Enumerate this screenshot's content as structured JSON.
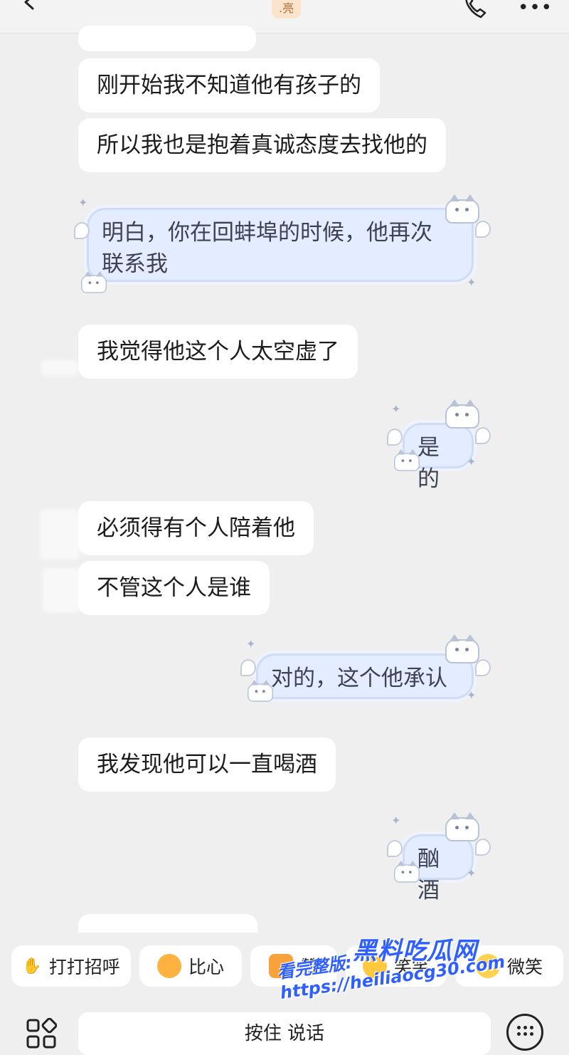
{
  "header": {
    "name_badge": ".亮",
    "more_label": "•••"
  },
  "messages": [
    {
      "side": "left",
      "text": ""
    },
    {
      "side": "left",
      "text": "刚开始我不知道他有孩子的"
    },
    {
      "side": "left",
      "text": "所以我也是抱着真诚态度去找他的"
    },
    {
      "side": "right",
      "text": "明白，你在回蚌埠的时候，他再次联系我",
      "line1": "明白，你在回蚌埠的时候，他再次",
      "line2": "联系我"
    },
    {
      "side": "left",
      "text": "我觉得他这个人太空虚了"
    },
    {
      "side": "right",
      "text": "是的"
    },
    {
      "side": "left",
      "text": "必须得有个人陪着他"
    },
    {
      "side": "left",
      "text": "不管这个人是谁"
    },
    {
      "side": "right",
      "text": "对的，这个他承认"
    },
    {
      "side": "left",
      "text": "我发现他可以一直喝酒"
    },
    {
      "side": "right",
      "text": "酗酒"
    },
    {
      "side": "left",
      "text": ""
    }
  ],
  "quick_replies": [
    {
      "label": "打打招呼",
      "icon": "wave-icon"
    },
    {
      "label": "比心",
      "icon": "heart-hands-icon"
    },
    {
      "label": "赞",
      "icon": "thumbs-up-icon"
    },
    {
      "label": "笑笑",
      "icon": "laugh-icon"
    },
    {
      "label": "微笑",
      "icon": "smile-icon"
    }
  ],
  "input": {
    "hold_to_talk": "按住 说话"
  },
  "watermark": {
    "brand": "黑料吃瓜网",
    "url_text": "看完整版: https://heiliaocg30.com"
  },
  "colors": {
    "chat_bg": "#efefef",
    "bubble": "#ffffff",
    "sticker_bg": "#e3edff",
    "watermark": "#2f5fff"
  }
}
